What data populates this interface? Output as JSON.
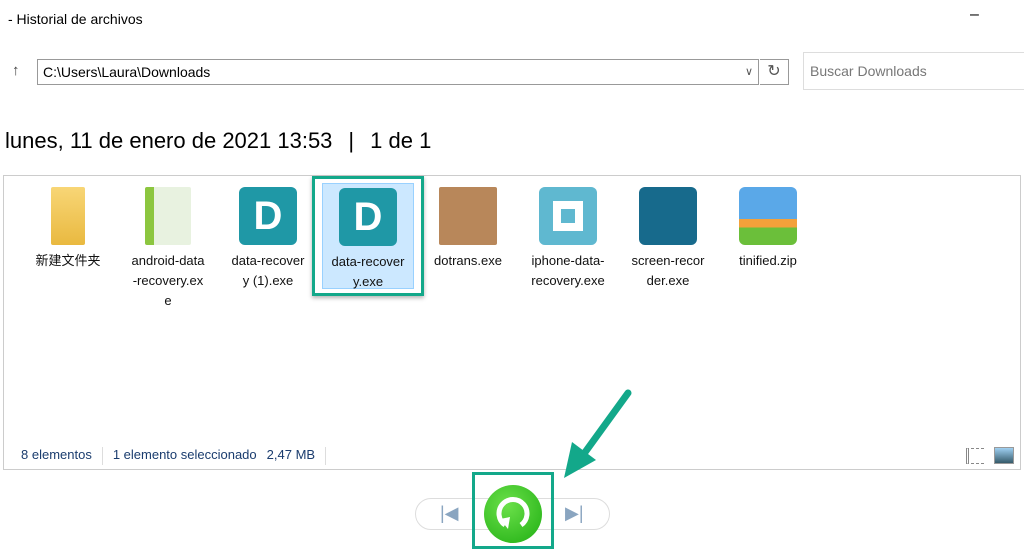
{
  "window": {
    "title": "- Historial de archivos",
    "minimize": "–"
  },
  "address": {
    "path": "C:\\Users\\Laura\\Downloads",
    "search_placeholder": "Buscar Downloads"
  },
  "header": {
    "date": "lunes, 11 de enero de 2021 13:53",
    "separator": "|",
    "page": "1 de 1"
  },
  "files": [
    {
      "name": "新建文件夹",
      "icon": "folder-icon"
    },
    {
      "name": "android-data-recovery.exe",
      "icon": "android-app-icon"
    },
    {
      "name": "data-recovery (1).exe",
      "icon": "data-recovery-icon"
    },
    {
      "name": "data-recovery.exe",
      "icon": "data-recovery-icon",
      "selected": true
    },
    {
      "name": "dotrans.exe",
      "icon": "box-icon"
    },
    {
      "name": "iphone-data-recovery.exe",
      "icon": "ring-icon"
    },
    {
      "name": "screen-recorder.exe",
      "icon": "camera-icon"
    },
    {
      "name": "tinified.zip",
      "icon": "archive-icon"
    }
  ],
  "status": {
    "count": "8 elementos",
    "selection": "1 elemento seleccionado",
    "size": "2,47 MB"
  },
  "colors": {
    "highlight": "#13a88a",
    "restore": "#2ec41c",
    "selection": "#cce8ff"
  }
}
